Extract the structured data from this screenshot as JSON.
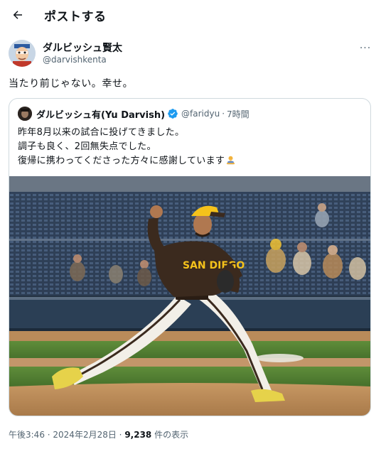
{
  "header": {
    "title": "ポストする"
  },
  "post": {
    "author_name": "ダルビッシュ賢太",
    "author_handle": "@darvishkenta",
    "text": "当たり前じゃない。幸せ。",
    "more_label": "···"
  },
  "quote": {
    "author_name": "ダルビッシュ有(Yu Darvish)",
    "author_handle": "@faridyu",
    "separator": "·",
    "time": "7時間",
    "lines": [
      "昨年8月以来の試合に投げてきました。",
      "調子も良く、2回無失点でした。",
      "復帰に携わってくださった方々に感謝しています"
    ],
    "image": {
      "jersey_text": "SAN DIEGO"
    }
  },
  "meta": {
    "time": "午後3:46",
    "separator1": " · ",
    "date": "2024年2月28日",
    "separator2": " · ",
    "views": "9,238",
    "views_suffix": " 件の表示"
  },
  "colors": {
    "text_primary": "#0f1419",
    "text_secondary": "#536471",
    "border": "#cfd9de",
    "verified": "#1d9bf0",
    "padres_brown": "#3b2a1e",
    "padres_gold": "#f5c21b"
  },
  "icons": {
    "back": "arrow-left-icon",
    "more": "more-dots-icon",
    "verified": "verified-badge-icon",
    "emoji": "bowing-person-emoji"
  }
}
